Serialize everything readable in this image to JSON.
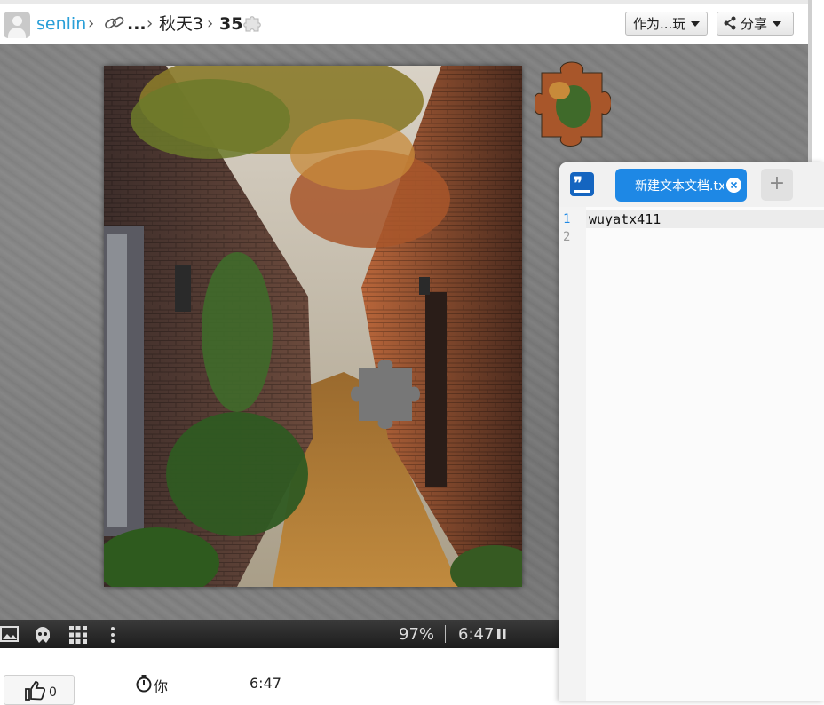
{
  "breadcrumb": {
    "user": "senlin",
    "ellipsis": "...",
    "album": "秋天3",
    "count": "35"
  },
  "toolbar": {
    "play_as_label": "作为...玩",
    "share_label": "分享"
  },
  "status": {
    "zoom": "97%",
    "timer": "6:47"
  },
  "stats": {
    "likes": "0",
    "player": "你",
    "player_time": "6:47"
  },
  "editor": {
    "tab_label": "新建文本文档.txt",
    "line_numbers": [
      "1",
      "2"
    ],
    "lines": [
      "wuyatx411",
      ""
    ],
    "new_tab_label": "+"
  },
  "colors": {
    "accent": "#2a9fd8",
    "editor_tab": "#1e88e5",
    "statusbar": "#2a2a2a",
    "table_bg": "#808080"
  },
  "icons": {
    "avatar": "default-avatar",
    "link": "link-icon",
    "puzzle": "puzzle-piece-icon",
    "share": "share-icon",
    "image": "image-icon",
    "ghost": "ghost-icon",
    "grid": "grid-icon",
    "menu": "more-vertical-icon",
    "pause": "pause-icon",
    "like": "thumbs-up-icon",
    "stopwatch": "stopwatch-icon"
  }
}
